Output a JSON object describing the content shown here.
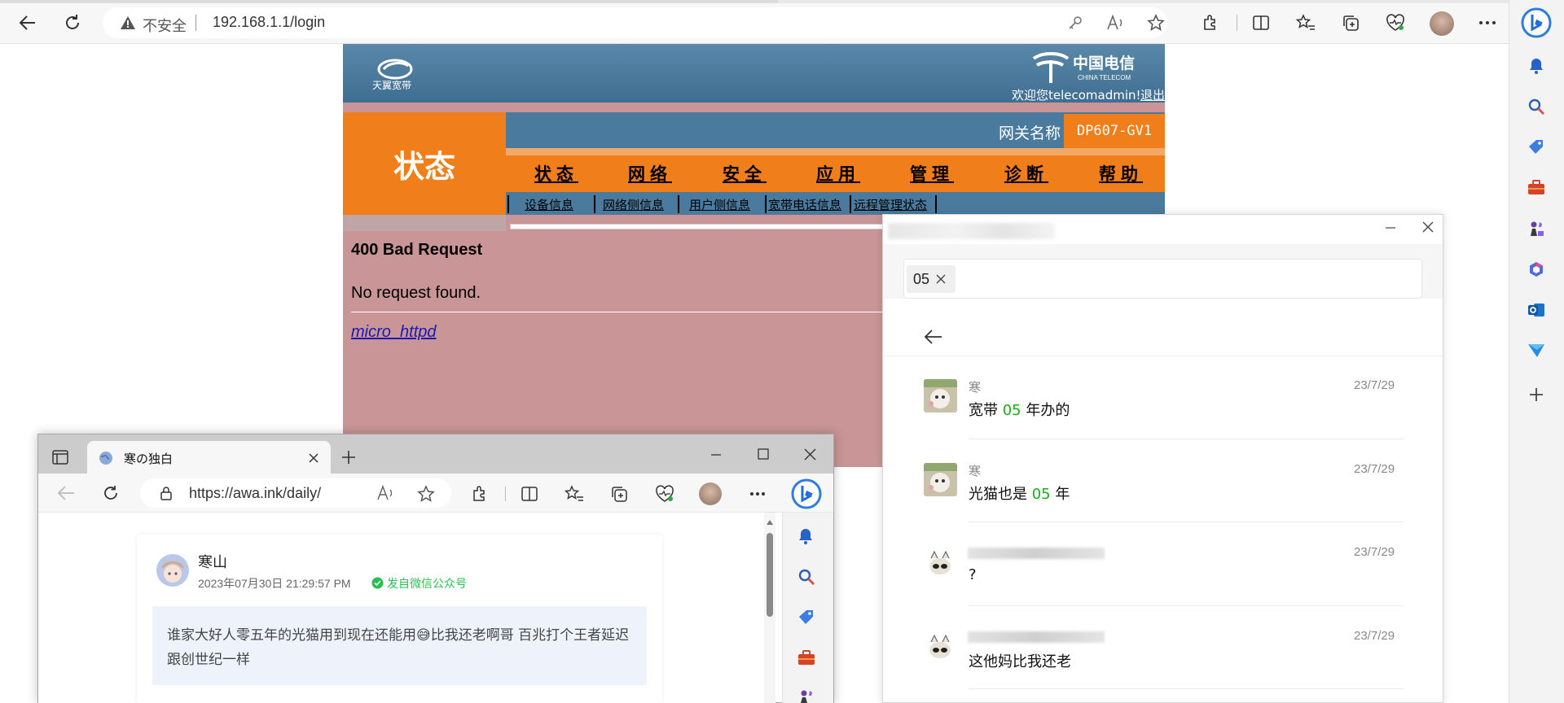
{
  "main_browser": {
    "insecure_label": "不安全",
    "url": "192.168.1.1/login"
  },
  "router": {
    "brand_left": "天翼宽带",
    "brand_right": "中国电信",
    "brand_right_en": "CHINA TELECOM",
    "welcome": "欢迎您telecomadmin!",
    "logout": "退出",
    "section_title": "状态",
    "gateway_label": "网关名称",
    "gateway_value": "DP607-GV1",
    "nav": [
      "状态",
      "网络",
      "安全",
      "应用",
      "管理",
      "诊断",
      "帮助"
    ],
    "subnav": [
      "设备信息",
      "网络侧信息",
      "用户侧信息",
      "宽带电话信息",
      "远程管理状态"
    ],
    "error_title": "400 Bad Request",
    "error_message": "No request found.",
    "server_link": "micro_httpd"
  },
  "chat_window": {
    "search_chip": "05",
    "messages": [
      {
        "name": "寒",
        "date": "23/7/29",
        "text_before": "宽带 ",
        "highlight": "05",
        "text_after": " 年办的"
      },
      {
        "name": "寒",
        "date": "23/7/29",
        "text_before": "光猫也是 ",
        "highlight": "05",
        "text_after": " 年"
      },
      {
        "name": "",
        "date": "23/7/29",
        "text_before": "?",
        "highlight": "",
        "text_after": ""
      },
      {
        "name": "",
        "date": "23/7/29",
        "text_before": "这他妈比我还老",
        "highlight": "",
        "text_after": ""
      }
    ]
  },
  "second_browser": {
    "tab_title": "寒の独白",
    "url": "https://awa.ink/daily/",
    "post": {
      "author": "寒山",
      "datetime": "2023年07月30日 21:29:57 PM",
      "source": "发自微信公众号",
      "content": "谁家大好人零五年的光猫用到现在还能用😅比我还老啊哥 百兆打个王者延迟跟创世纪一样"
    }
  },
  "colors": {
    "router_blue": "#4a7b9e",
    "router_orange": "#f07e1a",
    "error_bg": "#c99596",
    "highlight_green": "#1aad19",
    "source_green": "#2ac04f"
  }
}
